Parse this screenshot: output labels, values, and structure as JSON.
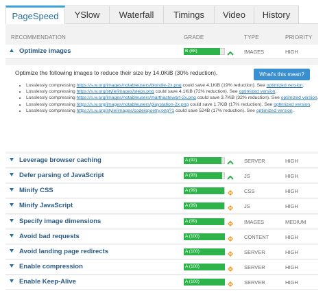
{
  "tabs": [
    "PageSpeed",
    "YSlow",
    "Waterfall",
    "Timings",
    "Video",
    "History"
  ],
  "active_tab": 0,
  "table_header": {
    "recommendation": "RECOMMENDATION",
    "grade": "GRADE",
    "type": "TYPE",
    "priority": "PRIORITY"
  },
  "expanded": {
    "label": "Optimize images",
    "grade": "B (88)",
    "grade_pct": 88,
    "type": "IMAGES",
    "priority": "HIGH",
    "intro": "Optimize the following images to reduce their size by 14.0KiB (30% reduction).",
    "button": "What's this mean?",
    "items": [
      {
        "pre": "Losslessly compressing ",
        "link": "https://s.w.org/images/notableusers/blondie-2x.png",
        "post": " could save 4.1KiB (19% reduction). See ",
        "see": "optimized version",
        "end": "."
      },
      {
        "pre": "Losslessly compressing ",
        "link": "https://s.w.org/style/images/steps.png",
        "post": " could save 4.1KiB (72% reduction). See ",
        "see": "optimized version",
        "end": "."
      },
      {
        "pre": "Losslessly compressing ",
        "link": "https://s.w.org/images/notableusers/marthastewart-2x.png",
        "post": " could save 3.7KiB (32% reduction). See ",
        "see": "optimized version",
        "end": "."
      },
      {
        "pre": "Losslessly compressing ",
        "link": "https://s.w.org/images/notableusers/playstation-2x.png",
        "post": " could save 1.7KiB (17% reduction). See ",
        "see": "optimized version",
        "end": "."
      },
      {
        "pre": "Losslessly compressing ",
        "link": "https://s.w.org/style/images/codeispoetry.png?1",
        "post": " could save 524B (17% reduction). See ",
        "see": "optimized version",
        "end": "."
      }
    ]
  },
  "rows": [
    {
      "label": "Leverage browser caching",
      "grade": "A (92)",
      "grade_pct": 92,
      "trend": "up",
      "type": "SERVER",
      "priority": "HIGH"
    },
    {
      "label": "Defer parsing of JavaScript",
      "grade": "A (93)",
      "grade_pct": 93,
      "trend": "up",
      "type": "JS",
      "priority": "HIGH"
    },
    {
      "label": "Minify CSS",
      "grade": "A (99)",
      "grade_pct": 99,
      "trend": "same",
      "type": "CSS",
      "priority": "HIGH"
    },
    {
      "label": "Minify JavaScript",
      "grade": "A (99)",
      "grade_pct": 99,
      "trend": "same",
      "type": "JS",
      "priority": "HIGH"
    },
    {
      "label": "Specify image dimensions",
      "grade": "A (99)",
      "grade_pct": 99,
      "trend": "same",
      "type": "IMAGES",
      "priority": "MEDIUM"
    },
    {
      "label": "Avoid bad requests",
      "grade": "A (100)",
      "grade_pct": 100,
      "trend": "same",
      "type": "CONTENT",
      "priority": "HIGH"
    },
    {
      "label": "Avoid landing page redirects",
      "grade": "A (100)",
      "grade_pct": 100,
      "trend": "same",
      "type": "SERVER",
      "priority": "HIGH"
    },
    {
      "label": "Enable compression",
      "grade": "A (100)",
      "grade_pct": 100,
      "trend": "same",
      "type": "SERVER",
      "priority": "HIGH"
    },
    {
      "label": "Enable Keep-Alive",
      "grade": "A (100)",
      "grade_pct": 100,
      "trend": "same",
      "type": "SERVER",
      "priority": "HIGH"
    }
  ],
  "colors": {
    "grade_green": "#2db34a",
    "trend_up": "#2db34a",
    "trend_same": "#f0a030",
    "accent": "#3aa0d6",
    "link": "#2a7ab8"
  },
  "icons": {
    "trend_up": "trend-up-icon",
    "trend_same": "trend-same-icon",
    "collapse": "chevron-up-icon",
    "expand": "chevron-down-icon"
  }
}
